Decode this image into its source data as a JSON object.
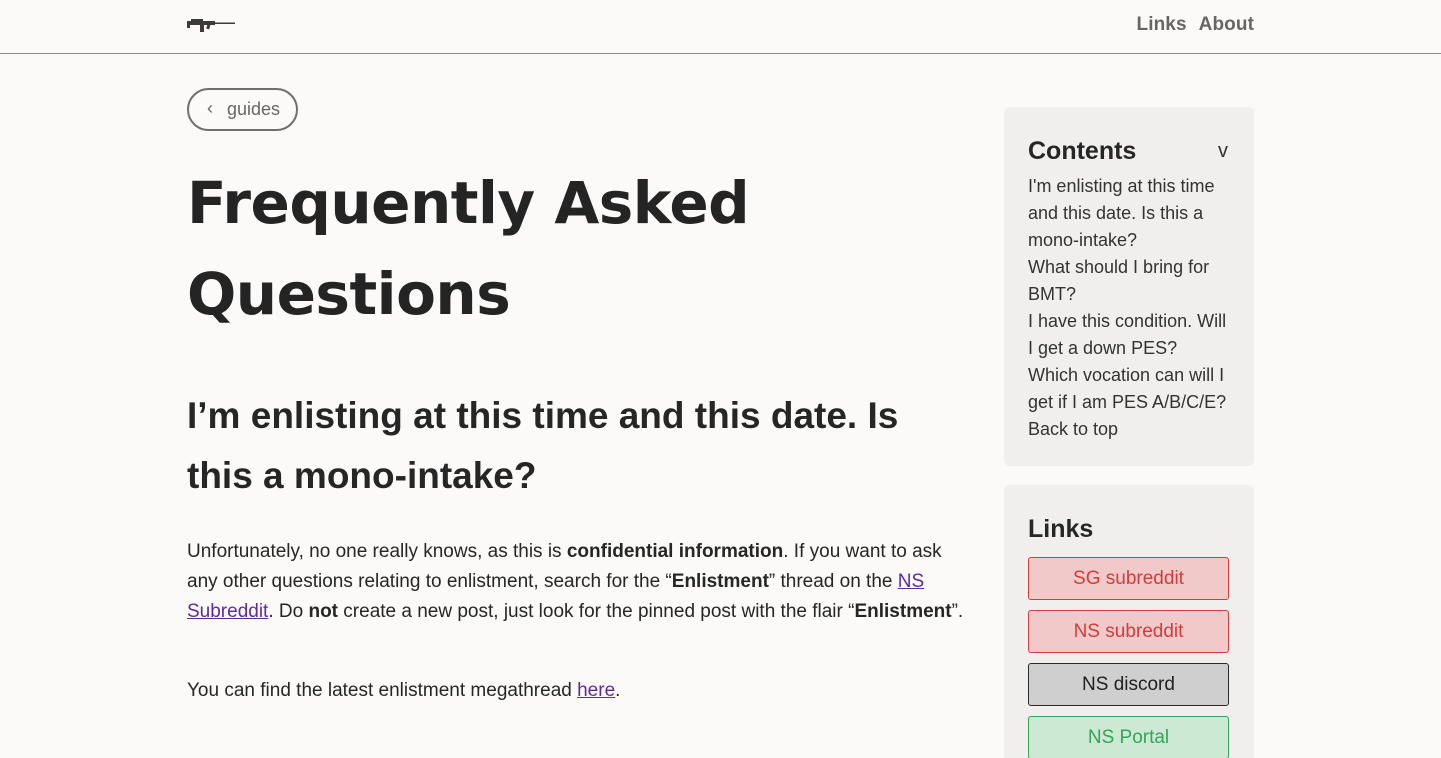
{
  "header": {
    "logo": "rifle-logo-icon",
    "nav": [
      "Links",
      "About"
    ]
  },
  "back_button": {
    "chevron": "‹",
    "label": "guides"
  },
  "page_title": "Frequently Asked Questions",
  "section": {
    "heading": "I’m enlisting at this time and this date. Is this a mono-intake?"
  },
  "paragraph1": {
    "t1": "Unfortunately, no one really knows, as this is ",
    "b1": "confidential information",
    "t2": ". If you want to ask any other questions relating to enlistment, search for the “",
    "b2": "Enlistment",
    "t3": "” thread on the ",
    "link": "NS Subreddit",
    "t4": ". Do ",
    "b3": "not",
    "t5": " create a new post, just look for the pinned post with the flair “",
    "b4": "Enlistment",
    "t6": "”."
  },
  "paragraph2": {
    "t1": "You can find the latest enlistment megathread ",
    "link": "here",
    "t2": "."
  },
  "toc": {
    "title": "Contents",
    "toggle": "v",
    "items": [
      "I'm enlisting at this time and this date. Is this a mono-intake?",
      "What should I bring for BMT?",
      "I have this condition. Will I get a down PES?",
      "Which vocation can will I get if I am PES A/B/C/E?",
      "Back to top"
    ]
  },
  "links": {
    "title": "Links",
    "items": [
      {
        "label": "SG subreddit",
        "style": "red"
      },
      {
        "label": "NS subreddit",
        "style": "red"
      },
      {
        "label": "NS discord",
        "style": "grey"
      },
      {
        "label": "NS Portal",
        "style": "green"
      }
    ]
  },
  "colors": {
    "background": "#fbfaf8",
    "link_purple": "#5a2ca0",
    "red": "#d23c3c",
    "green": "#35a35a"
  }
}
